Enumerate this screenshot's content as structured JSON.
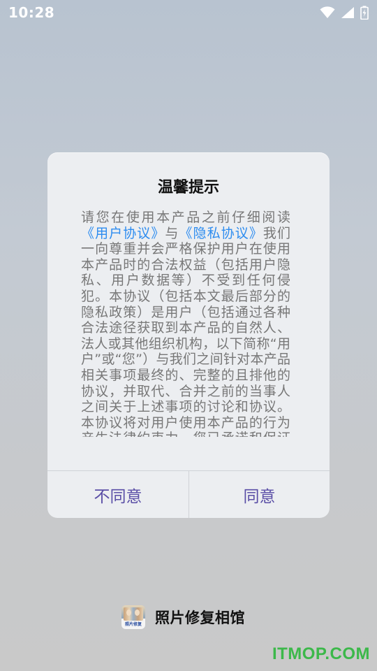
{
  "status_bar": {
    "time": "10:28",
    "icons": [
      "wifi-icon",
      "cellular-signal-icon",
      "battery-charging-icon"
    ]
  },
  "dialog": {
    "title": "温馨提示",
    "body": {
      "intro": "请您在使用本产品之前仔细阅读",
      "user_agreement_link": "《用户协议》",
      "conjunction": "与",
      "privacy_policy_link": "《隐私协议》",
      "rest": "我们一向尊重并会严格保护用户在使用本产品时的合法权益（包括用户隐私、用户数据等）不受到任何侵犯。本协议（包括本文最后部分的隐私政策）是用户（包括通过各种合法途径获取到本产品的自然人、法人或其他组织机构，以下简称“用户”或“您”）与我们之间针对本产品相关事项最终的、完整的且排他的协议，并取代、合并之前的当事人之间关于上述事项的讨论和协议。本协议将对用户使用本产品的行为产生法律约束力，您已承诺和保证有"
    },
    "buttons": {
      "disagree": "不同意",
      "agree": "同意"
    }
  },
  "app": {
    "logo_caption": "照片修复",
    "name": "照片修复相馆"
  },
  "watermark": "ITMOP.COM",
  "colors": {
    "link": "#2d8cf0",
    "button_text": "#5a4ea6",
    "watermark": "#3cb84a"
  }
}
